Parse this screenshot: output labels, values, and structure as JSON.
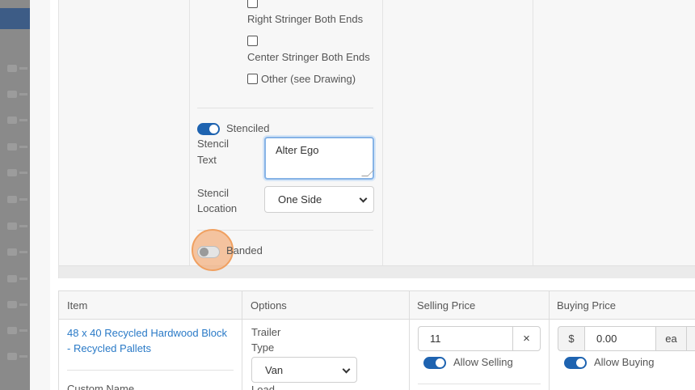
{
  "stringer_options": {
    "right_stringer": "Right Stringer Both Ends",
    "center_stringer": "Center Stringer Both Ends",
    "other": "Other (see Drawing)"
  },
  "stenciled": {
    "label": "Stenciled",
    "on": true
  },
  "stencil_text": {
    "label_line1": "Stencil",
    "label_line2": "Text",
    "value": "Alter Ego"
  },
  "stencil_location": {
    "label_line1": "Stencil",
    "label_line2": "Location",
    "value": "One Side"
  },
  "banded": {
    "label": "Banded",
    "on": false
  },
  "table": {
    "headers": [
      "Item",
      "Options",
      "Selling Price",
      "Buying Price"
    ],
    "item": {
      "link_line1": "48 x 40 Recycled Hardwood Block",
      "link_line2": "- Recycled Pallets",
      "custom_name_label": "Custom Name"
    },
    "options": {
      "trailer_type_line1": "Trailer",
      "trailer_type_line2": "Type",
      "trailer_type_value": "Van",
      "load_label": "Load"
    },
    "selling": {
      "value": "11",
      "clear_symbol": "×",
      "allow_label": "Allow Selling",
      "allow_on": true
    },
    "buying": {
      "currency": "$",
      "value": "0.00",
      "unit": "ea",
      "allow_label": "Allow Buying",
      "allow_on": true
    }
  },
  "colors": {
    "accent": "#1e63b0",
    "link": "#2a7ac7",
    "click_highlight": "#f3a870"
  }
}
